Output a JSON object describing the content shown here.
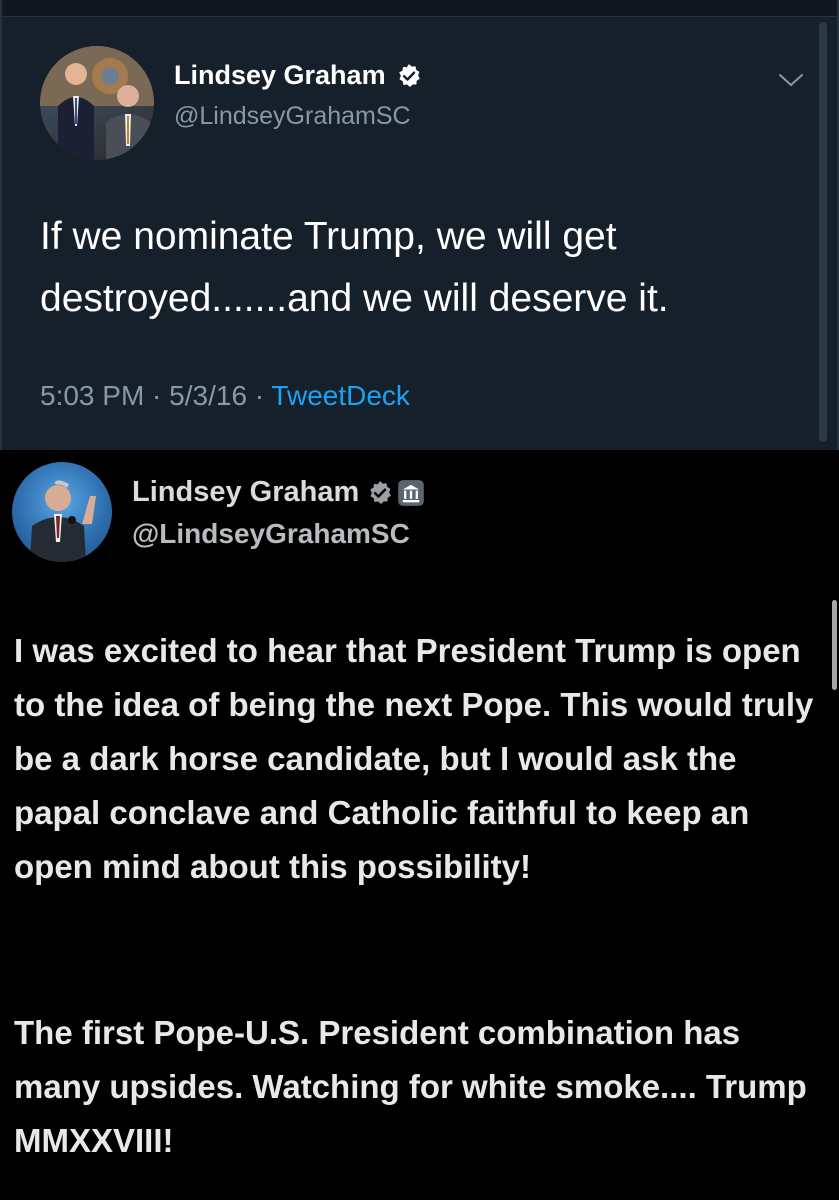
{
  "tweet_old": {
    "name": "Lindsey Graham",
    "handle": "@LindseyGrahamSC",
    "text": "If we nominate Trump, we will get destroyed.......and we will deserve it.",
    "time": "5:03 PM",
    "sep1": " · ",
    "date": "5/3/16",
    "sep2": " · ",
    "source": "TweetDeck",
    "colors": {
      "background": "#15202b",
      "link": "#1da1f2",
      "muted": "#8899a6"
    }
  },
  "tweet_new": {
    "name": "Lindsey Graham",
    "handle": "@LindseyGrahamSC",
    "paragraphs": [
      "I was excited to hear that President Trump is open to the idea of being the next Pope. This would truly be a dark horse candidate, but I would ask the papal conclave and Catholic faithful to keep an open mind about this possibility!",
      "The first Pope-U.S. President combination has many upsides. Watching for white smoke.... Trump MMXXVIII!"
    ],
    "colors": {
      "background": "#000000",
      "text": "#e8e8e8"
    }
  }
}
